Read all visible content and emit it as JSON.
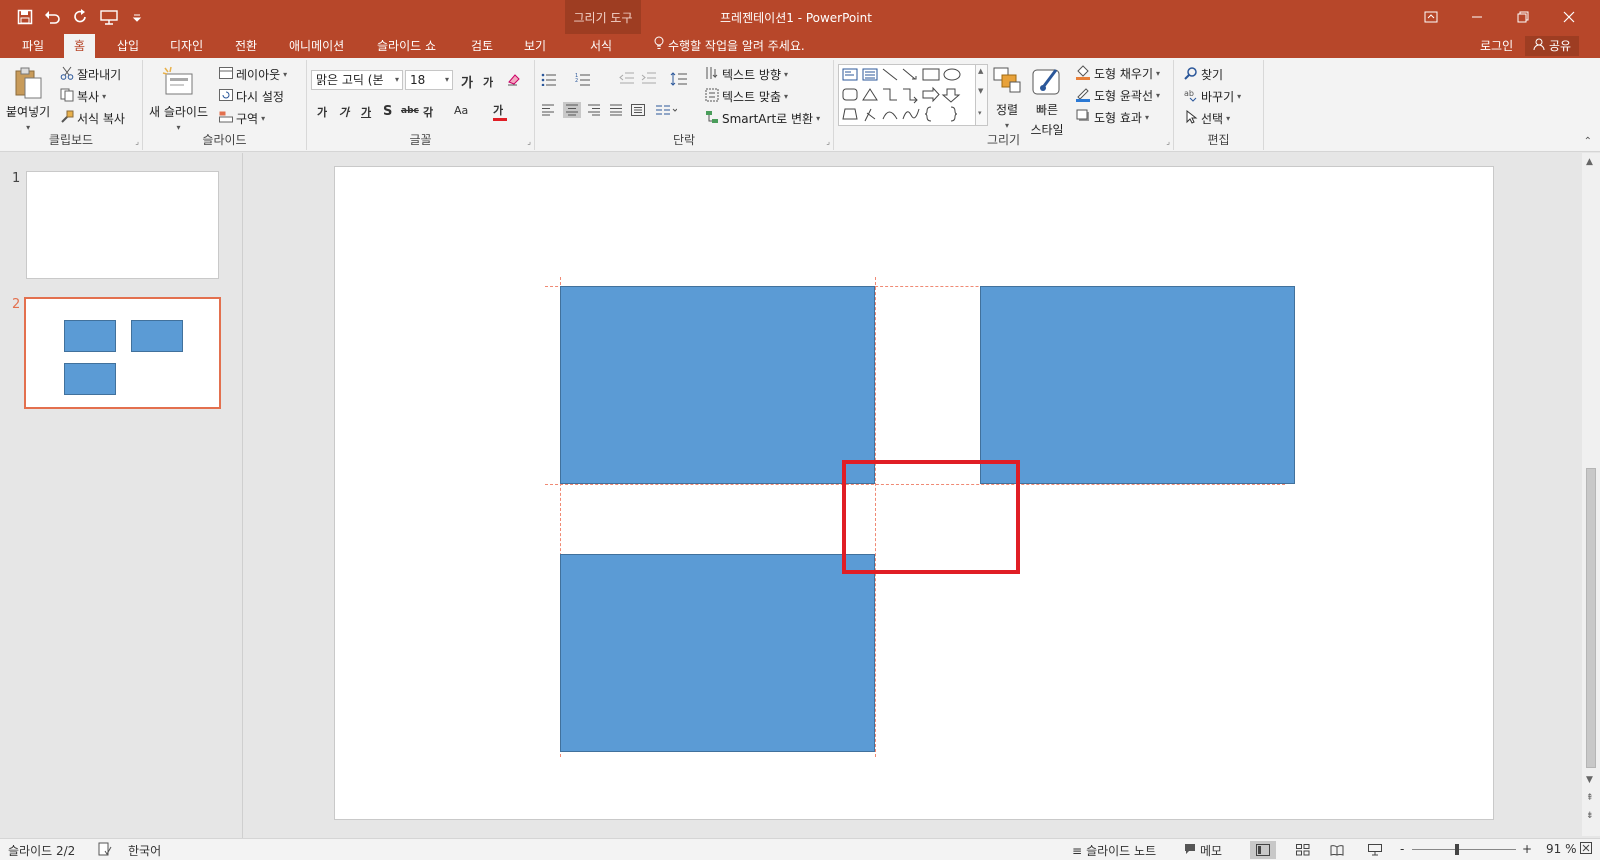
{
  "app": {
    "title": "프레젠테이션1 - PowerPoint",
    "context_tab_group": "그리기 도구",
    "accent_color": "#b7472a",
    "icons": {
      "save": "save-icon",
      "undo": "undo-icon",
      "redo": "redo-icon",
      "present": "present-icon",
      "customize": "qat-customize-icon",
      "ribbon_display": "ribbon-display-options-icon",
      "minimize": "minimize-icon",
      "restore": "restore-icon",
      "close": "close-icon"
    }
  },
  "tabs": [
    {
      "label": "파일"
    },
    {
      "label": "홈",
      "active": true
    },
    {
      "label": "삽입"
    },
    {
      "label": "디자인"
    },
    {
      "label": "전환"
    },
    {
      "label": "애니메이션"
    },
    {
      "label": "슬라이드 쇼"
    },
    {
      "label": "검토"
    },
    {
      "label": "보기"
    },
    {
      "label": "서식"
    }
  ],
  "tell_me": "수행할 작업을 알려 주세요.",
  "account": {
    "login": "로그인",
    "share": "공유"
  },
  "ribbon": {
    "clipboard": {
      "label": "클립보드",
      "paste": "붙여넣기",
      "cut": "잘라내기",
      "copy": "복사",
      "format_painter": "서식 복사"
    },
    "slides": {
      "label": "슬라이드",
      "new_slide": "새 슬라이드",
      "layout": "레이아웃",
      "reset": "다시 설정",
      "section": "구역"
    },
    "font": {
      "label": "글꼴",
      "font_name": "맑은 고딕 (본",
      "font_size": "18",
      "grow": "가",
      "shrink": "가",
      "bold": "가",
      "italic": "가",
      "underline": "가",
      "shadow": "S",
      "strike": "abc",
      "spacing": "갂",
      "case": "Aa",
      "color": "가",
      "font_color_bar": "#e01e25"
    },
    "paragraph": {
      "label": "단락",
      "text_direction": "텍스트 방향",
      "align_text": "텍스트 맞춤",
      "smartart": "SmartArt로 변환"
    },
    "drawing": {
      "label": "그리기",
      "arrange": "정렬",
      "quick_styles_1": "빠른",
      "quick_styles_2": "스타일",
      "shape_fill": "도형 채우기",
      "shape_outline": "도형 윤곽선",
      "shape_effects": "도형 효과"
    },
    "editing": {
      "label": "편집",
      "find": "찾기",
      "replace": "바꾸기",
      "select": "선택"
    }
  },
  "slides_panel": [
    {
      "number": "1",
      "shape_count": 0
    },
    {
      "number": "2",
      "shape_count": 3,
      "selected": true
    }
  ],
  "slide": {
    "shape_fill": "#5b9bd5",
    "shape_outline": "#41719c",
    "guide_color": "#f08a74",
    "highlight_color": "#e01e25",
    "shape_count": 3
  },
  "status": {
    "slide_info": "슬라이드 2/2",
    "language": "한국어",
    "notes": "슬라이드 노트",
    "comments": "메모",
    "zoom": "91 %",
    "zoom_minus": "-",
    "zoom_plus": "+"
  }
}
